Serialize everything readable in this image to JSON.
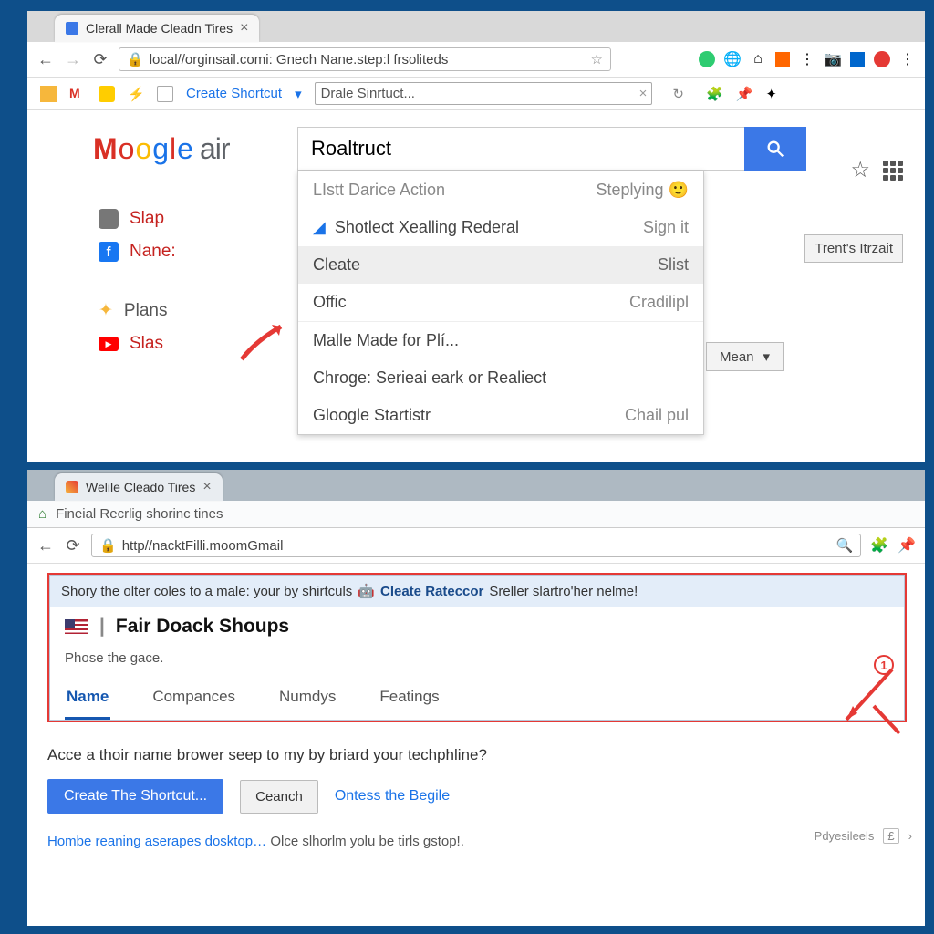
{
  "top": {
    "tab_title": "Clerall Made Cleadn Tires",
    "url": "local//orginsail.comi: Gnech Nane.step:l frsoliteds",
    "bookmarks": {
      "create_shortcut": "Create Shortcut",
      "input_value": "Drale Sinrtuct..."
    },
    "logo_text": "air",
    "left_nav": [
      {
        "icon": "chat-icon",
        "label": "Slap"
      },
      {
        "icon": "facebook-icon",
        "label": "Nane:"
      },
      {
        "icon": "plans-icon",
        "label": "Plans"
      },
      {
        "icon": "youtube-icon",
        "label": "Slas"
      }
    ],
    "search_value": "Roaltruct",
    "toolbar_button": "Trent's Itrzait",
    "mean_button": "Mean",
    "suggestions": {
      "header": {
        "left": "LIstt Darice Action",
        "right": "Steplying"
      },
      "rows": [
        {
          "left": "Shotlect Xealling Rederal",
          "right": "Sign it",
          "icon": "chart-icon"
        },
        {
          "left": "Cleate",
          "right": "Slist",
          "selected": true
        },
        {
          "left": "Offic",
          "right": "Cradilipl"
        },
        {
          "left": "Malle Made for Plí..."
        },
        {
          "left": "Chroge: Serieai eark or Realiect"
        },
        {
          "left": "Gloogle Startistr",
          "right": "Chail pul"
        }
      ]
    }
  },
  "bottom": {
    "tab_title": "Welile Cleado Tires",
    "breadcrumb": "Fineial Recrlig shorinc tines",
    "url": "http//nacktFilli.moomGmail",
    "infobar_pre": "Shory the olter coles to a male: your by shirtculs",
    "infobar_hl": "Cleate Rateccor",
    "infobar_post": "Sreller slartro'her nelme!",
    "panel_title": "Fair Doack Shoups",
    "panel_sub": "Phose the gace.",
    "tabs": [
      "Name",
      "Compances",
      "Numdys",
      "Featings"
    ],
    "active_tab": 0,
    "question": "Acce a thoir name brower seep to my by briard your techphline?",
    "primary_btn": "Create The Shortcut...",
    "secondary_btn": "Ceanch",
    "link": "Ontess the Begile",
    "tip_link": "Hombe reaning aserapes dosktop…",
    "tip_rest": "Olce slhorlm yolu be tirls gstop!.",
    "callout_badge": "1",
    "footer": "Pdyesileels"
  }
}
